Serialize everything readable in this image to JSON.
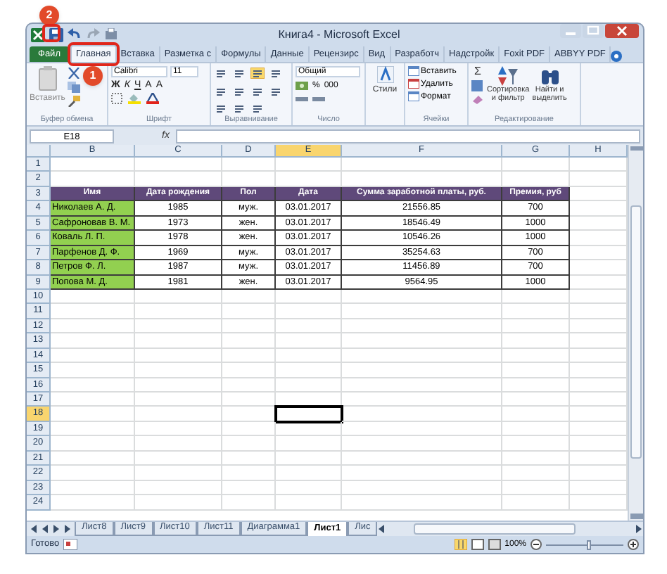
{
  "window": {
    "title": "Книга4 - Microsoft Excel"
  },
  "callouts": [
    {
      "label": "1"
    },
    {
      "label": "2"
    }
  ],
  "ribbon_tabs": [
    {
      "label": "Файл",
      "selected": false,
      "kind": "file"
    },
    {
      "label": "Главная",
      "selected": true,
      "kind": "tab"
    },
    {
      "label": "Вставка",
      "selected": false,
      "kind": "tab"
    },
    {
      "label": "Разметка с",
      "selected": false,
      "kind": "tab"
    },
    {
      "label": "Формулы",
      "selected": false,
      "kind": "tab"
    },
    {
      "label": "Данные",
      "selected": false,
      "kind": "tab"
    },
    {
      "label": "Рецензирс",
      "selected": false,
      "kind": "tab"
    },
    {
      "label": "Вид",
      "selected": false,
      "kind": "tab"
    },
    {
      "label": "Разработч",
      "selected": false,
      "kind": "tab"
    },
    {
      "label": "Надстройк",
      "selected": false,
      "kind": "tab"
    },
    {
      "label": "Foxit PDF",
      "selected": false,
      "kind": "tab"
    },
    {
      "label": "ABBYY PDF",
      "selected": false,
      "kind": "tab"
    }
  ],
  "ribbon_groups": [
    {
      "kind": "clipboard",
      "label": "Буфер обмена",
      "controls": [
        "Вставить"
      ]
    },
    {
      "kind": "font",
      "label": "Шрифт",
      "controls": [
        "Calibri",
        "11",
        "Ж",
        "К",
        "Ч",
        "A",
        "A"
      ]
    },
    {
      "kind": "alignment",
      "label": "Выравнивание"
    },
    {
      "kind": "number",
      "label": "Число",
      "controls": [
        "Общий",
        "%",
        "000"
      ]
    },
    {
      "kind": "styles",
      "controls": [
        "Стили"
      ]
    },
    {
      "kind": "cells",
      "label": "Ячейки",
      "controls": [
        "Вставить",
        "Удалить",
        "Формат"
      ]
    },
    {
      "kind": "editing",
      "label": "Редактирование",
      "controls": [
        "Σ",
        "Сортировка",
        "и фильтр",
        "Найти и",
        "выделить"
      ]
    }
  ],
  "formula_bar": {
    "name_box": "E18",
    "fx": "fx"
  },
  "columns": [
    {
      "label": "B",
      "selected": false
    },
    {
      "label": "C",
      "selected": false
    },
    {
      "label": "D",
      "selected": false
    },
    {
      "label": "E",
      "selected": true
    },
    {
      "label": "F",
      "selected": false
    },
    {
      "label": "G",
      "selected": false
    },
    {
      "label": "H",
      "selected": false
    }
  ],
  "rows": [
    {
      "number": "1",
      "selected": false,
      "kind": "empty"
    },
    {
      "number": "2",
      "selected": false,
      "kind": "empty"
    },
    {
      "number": "3",
      "selected": false,
      "kind": "header",
      "cells": [
        "Имя",
        "Дата рождения",
        "Пол",
        "Дата",
        "Сумма заработной платы, руб.",
        "Премия, руб"
      ]
    },
    {
      "number": "4",
      "selected": false,
      "kind": "data",
      "cells": [
        "Николаев А. Д.",
        "1985",
        "муж.",
        "03.01.2017",
        "21556.85",
        "700"
      ]
    },
    {
      "number": "5",
      "selected": false,
      "kind": "data",
      "cells": [
        "Сафроновав В. М.",
        "1973",
        "жен.",
        "03.01.2017",
        "18546.49",
        "1000"
      ]
    },
    {
      "number": "6",
      "selected": false,
      "kind": "data",
      "cells": [
        "Коваль Л. П.",
        "1978",
        "жен.",
        "03.01.2017",
        "10546.26",
        "1000"
      ]
    },
    {
      "number": "7",
      "selected": false,
      "kind": "data",
      "cells": [
        "Парфенов Д. Ф.",
        "1969",
        "муж.",
        "03.01.2017",
        "35254.63",
        "700"
      ]
    },
    {
      "number": "8",
      "selected": false,
      "kind": "data",
      "cells": [
        "Петров Ф. Л.",
        "1987",
        "муж.",
        "03.01.2017",
        "11456.89",
        "700"
      ]
    },
    {
      "number": "9",
      "selected": false,
      "kind": "data",
      "cells": [
        "Попова М. Д.",
        "1981",
        "жен.",
        "03.01.2017",
        "9564.95",
        "1000"
      ]
    },
    {
      "number": "10",
      "selected": false,
      "kind": "empty"
    },
    {
      "number": "11",
      "selected": false,
      "kind": "empty"
    },
    {
      "number": "12",
      "selected": false,
      "kind": "empty"
    },
    {
      "number": "13",
      "selected": false,
      "kind": "empty"
    },
    {
      "number": "14",
      "selected": false,
      "kind": "empty"
    },
    {
      "number": "15",
      "selected": false,
      "kind": "empty"
    },
    {
      "number": "16",
      "selected": false,
      "kind": "empty"
    },
    {
      "number": "17",
      "selected": false,
      "kind": "empty"
    },
    {
      "number": "18",
      "selected": true,
      "kind": "empty"
    },
    {
      "number": "19",
      "selected": false,
      "kind": "empty"
    },
    {
      "number": "20",
      "selected": false,
      "kind": "empty"
    },
    {
      "number": "21",
      "selected": false,
      "kind": "empty"
    },
    {
      "number": "22",
      "selected": false,
      "kind": "empty"
    },
    {
      "number": "23",
      "selected": false,
      "kind": "empty"
    },
    {
      "number": "24",
      "selected": false,
      "kind": "empty"
    }
  ],
  "sheet_tabs": [
    {
      "label": "Лист8",
      "selected": false
    },
    {
      "label": "Лист9",
      "selected": false
    },
    {
      "label": "Лист10",
      "selected": false
    },
    {
      "label": "Лист11",
      "selected": false
    },
    {
      "label": "Диаграмма1",
      "selected": false
    },
    {
      "label": "Лист1",
      "selected": true
    },
    {
      "label": "Лис",
      "selected": false
    }
  ],
  "status_bar": {
    "text": "Готово",
    "zoom": {
      "text": "100%",
      "level": 0.55
    }
  }
}
